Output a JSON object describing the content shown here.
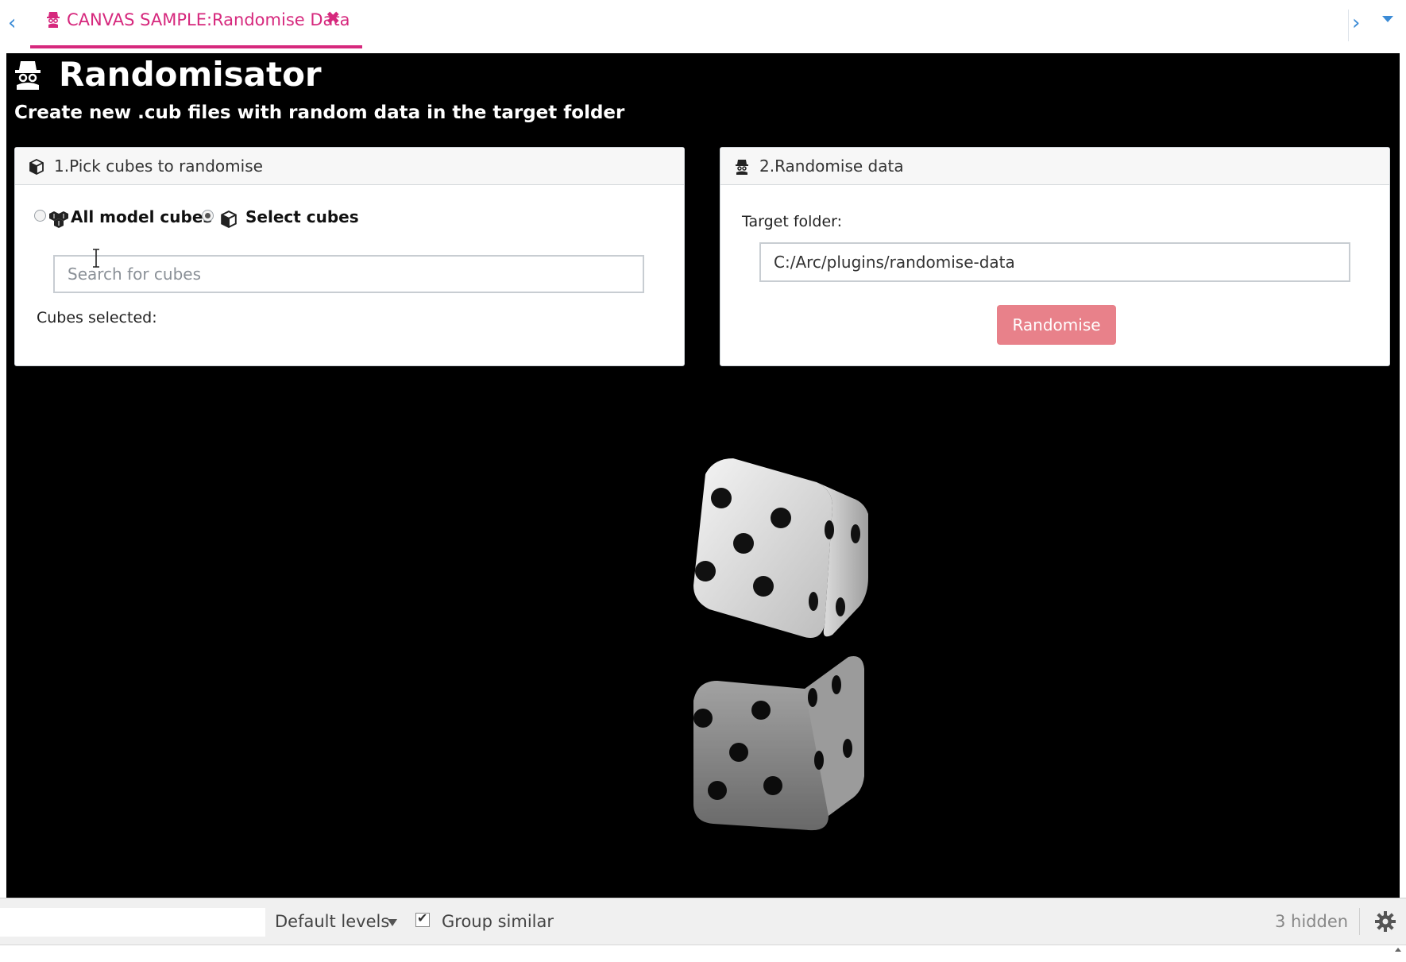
{
  "tab": {
    "title": "CANVAS SAMPLE:Randomise Data",
    "close_symbol": "✖",
    "nav_left_symbol": "‹",
    "nav_right_symbol": "›",
    "accent_color": "#d6287d"
  },
  "app": {
    "title": "Randomisator",
    "subtitle": "Create new .cub files with random data in the target folder",
    "icon": "spy-icon"
  },
  "pick_panel": {
    "header": "1.Pick cubes to randomise",
    "header_icon": "cube-icon",
    "options": [
      {
        "label": "All model cubes",
        "icon": "cubes-icon",
        "selected": false
      },
      {
        "label": "Select cubes",
        "icon": "cube-icon",
        "selected": true
      }
    ],
    "search_placeholder": "Search for cubes",
    "search_value": "",
    "selected_label": "Cubes selected:"
  },
  "randomise_panel": {
    "header": "2.Randomise data",
    "header_icon": "spy-icon",
    "folder_label": "Target folder:",
    "folder_value": "C:/Arc/plugins/randomise-data",
    "button_label": "Randomise",
    "button_color": "#e8818a"
  },
  "background_image": {
    "description_icon": "dice-icon"
  },
  "bottom_bar": {
    "filter_value": "",
    "levels_label": "Default levels",
    "group_label": "Group similar",
    "group_checked": true,
    "hidden_label": "3 hidden",
    "settings_icon": "gear-icon"
  }
}
